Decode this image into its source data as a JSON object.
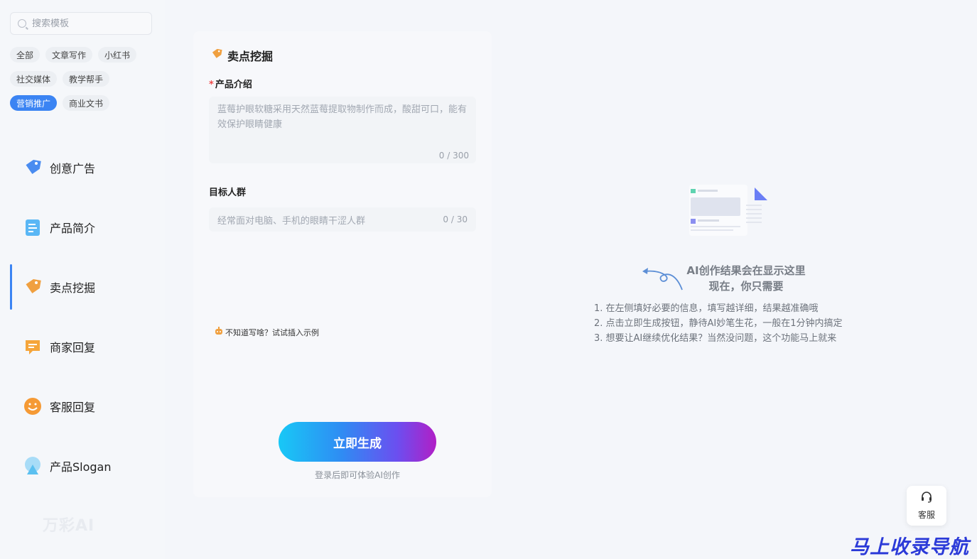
{
  "search": {
    "placeholder": "搜索模板"
  },
  "tags": [
    [
      "全部",
      "文章写作",
      "小红书"
    ],
    [
      "社交媒体",
      "教学帮手"
    ],
    [
      "营销推广",
      "商业文书"
    ]
  ],
  "menu": [
    {
      "label": "创意广告",
      "icon": "price-tag-icon",
      "color": "#4a8cf0"
    },
    {
      "label": "产品简介",
      "icon": "document-icon",
      "color": "#5ab7f5"
    },
    {
      "label": "卖点挖掘",
      "icon": "price-tag-icon",
      "color": "#f0a040"
    },
    {
      "label": "商家回复",
      "icon": "chat-bubble-icon",
      "color": "#f5a53a"
    },
    {
      "label": "客服回复",
      "icon": "smiley-icon",
      "color": "#f59a35"
    },
    {
      "label": "产品Slogan",
      "icon": "mountain-icon",
      "color": "#5bc0f0"
    }
  ],
  "logo": "万彩AI",
  "form": {
    "title": "卖点挖掘",
    "field1": {
      "required_mark": "*",
      "label": "产品介绍",
      "placeholder": "蓝莓护眼软糖采用天然蓝莓提取物制作而成，酸甜可口，能有效保护眼睛健康",
      "counter": "0 / 300"
    },
    "field2": {
      "label": "目标人群",
      "placeholder": "经常面对电脑、手机的眼睛干涩人群",
      "counter": "0 / 30"
    },
    "example_hint": "不知道写啥？试试插入示例",
    "generate_label": "立即生成",
    "login_hint": "登录后即可体验AI创作"
  },
  "result": {
    "title_line1": "AI创作结果会在显示这里",
    "title_line2": "现在，你只需要",
    "steps": [
      "1. 在左侧填好必要的信息，填写越详细，结果越准确哦",
      "2. 点击立即生成按钮，静待AI妙笔生花，一般在1分钟内搞定",
      "3. 想要让AI继续优化结果？当然没问题，这个功能马上就来"
    ]
  },
  "support": {
    "label": "客服"
  },
  "watermark": "马上收录导航",
  "colors": {
    "accent": "#3b84f3",
    "required": "#f04b4b"
  }
}
